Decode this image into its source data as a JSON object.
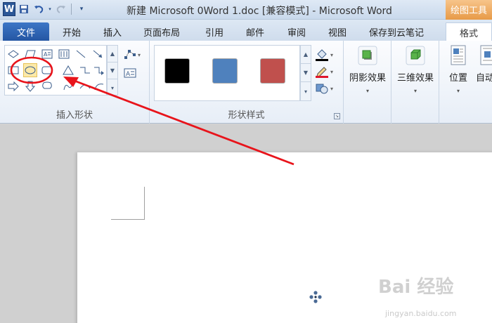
{
  "app": {
    "logo_letter": "W",
    "title": "新建 Microsoft 0Word 1.doc [兼容模式] - Microsoft Word",
    "context_tab_title": "绘图工具"
  },
  "quick_access": {
    "save_icon": "save-icon",
    "undo_icon": "undo-icon",
    "redo_icon": "redo-icon",
    "customize_icon": "customize-icon"
  },
  "tabs": {
    "file": "文件",
    "home": "开始",
    "insert": "插入",
    "layout": "页面布局",
    "references": "引用",
    "mailings": "邮件",
    "review": "审阅",
    "view": "视图",
    "cloud": "保存到云笔记",
    "format": "格式"
  },
  "ribbon": {
    "insert_shapes_label": "插入形状",
    "shape_styles_label": "形状样式",
    "shadow_effects": "阴影效果",
    "three_d_effects": "三维效果",
    "position": "位置",
    "auto_wrap": "自动换行",
    "style_swatches": [
      "#000000",
      "#4f81bd",
      "#c0504d"
    ]
  },
  "annotation_colors": {
    "circle": "#e8141b",
    "arrow": "#e8141b"
  },
  "watermark": {
    "text": "Bai 经验",
    "url": "jingyan.baidu.com"
  }
}
